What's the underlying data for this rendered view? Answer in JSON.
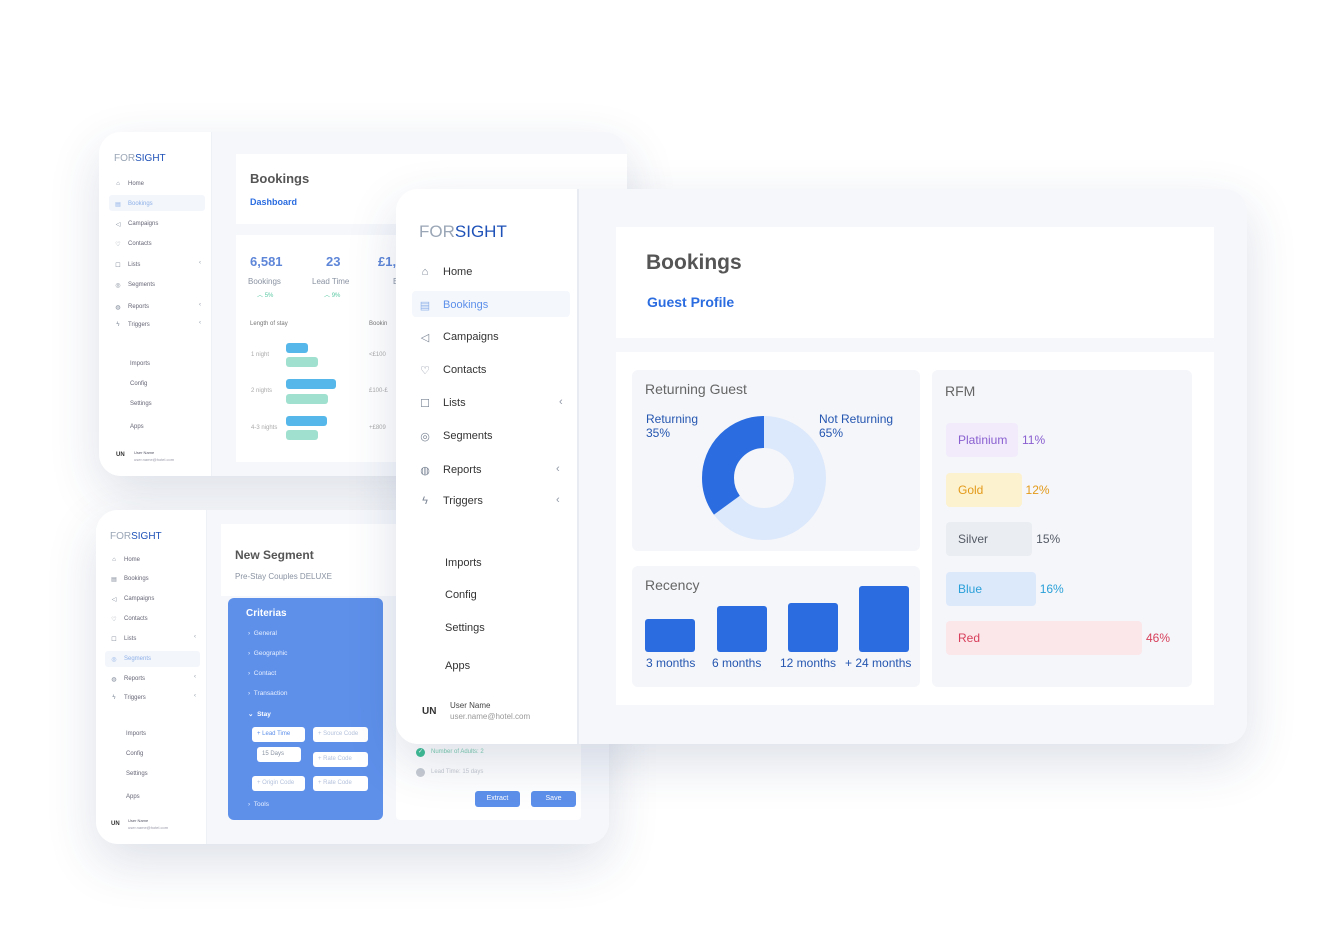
{
  "brand": {
    "logo_for": "FOR",
    "logo_sight": "SIGHT",
    "accent": "#2b6de0",
    "dark_blue": "#1f52b8"
  },
  "nav": {
    "items": [
      {
        "label": "Home",
        "icon": "home-icon"
      },
      {
        "label": "Bookings",
        "icon": "calendar-icon"
      },
      {
        "label": "Campaigns",
        "icon": "megaphone-icon"
      },
      {
        "label": "Contacts",
        "icon": "people-icon"
      },
      {
        "label": "Lists",
        "icon": "list-icon"
      },
      {
        "label": "Segments",
        "icon": "target-icon"
      },
      {
        "label": "Reports",
        "icon": "reports-icon"
      },
      {
        "label": "Triggers",
        "icon": "trigger-icon"
      }
    ],
    "sub_items": [
      "Imports",
      "Config",
      "Settings",
      "Apps"
    ],
    "user": {
      "initials": "UN",
      "name": "User Name",
      "email": "user.name@hotel.com"
    }
  },
  "card1": {
    "title": "Bookings",
    "subtitle": "Dashboard",
    "kpis": [
      {
        "value": "6,581",
        "label": "Bookings",
        "delta": "5%"
      },
      {
        "value": "23",
        "label": "Lead Time",
        "delta": "9%"
      },
      {
        "value": "£1,",
        "label": "B"
      }
    ],
    "length_of_stay": {
      "header": "Length of stay",
      "header2": "Bookin",
      "rows": [
        {
          "label": "1 night",
          "amount": "<£100"
        },
        {
          "label": "2 nights",
          "amount": "£100-£"
        },
        {
          "label": "4-3 nights",
          "amount": "+£809"
        }
      ]
    }
  },
  "card2": {
    "title": "New Segment",
    "subtitle": "Pre-Stay Couples DELUXE",
    "criterias": {
      "title": "Criterias",
      "items": [
        "General",
        "Geographic",
        "Contact",
        "Transaction",
        "Stay",
        "Tools"
      ],
      "tags": {
        "lead_time": "+ Lead Time",
        "days": "15 Days",
        "source_code": "+ Source Code",
        "rate_code": "+ Rate Code",
        "origin_code": "+ Origin Code",
        "rate_code2": "+ Rate Code"
      }
    },
    "conditions": [
      "Number of Adults: 2",
      "Lead Time: 15 days"
    ],
    "buttons": {
      "extract": "Extract",
      "save": "Save"
    }
  },
  "card3": {
    "title": "Bookings",
    "subtitle": "Guest Profile",
    "returning_guest": {
      "title": "Returning Guest",
      "returning_label": "Returning",
      "returning_pct": "35%",
      "not_returning_label": "Not Returning",
      "not_returning_pct": "65%",
      "returning_value": 35,
      "not_returning_value": 65,
      "colors": {
        "returning": "#2b6de0",
        "not_returning": "#dce8fb"
      }
    },
    "recency": {
      "title": "Recency",
      "categories": [
        "3 months",
        "6 months",
        "12 months",
        "+ 24 months"
      ],
      "values": [
        1.0,
        1.4,
        1.5,
        2.0
      ]
    },
    "rfm": {
      "title": "RFM",
      "tiers": [
        {
          "label": "Platinium",
          "pct": "11%",
          "value": 11,
          "bg": "#f1ebfb",
          "fg": "#8a5fd0"
        },
        {
          "label": "Gold",
          "pct": "12%",
          "value": 12,
          "bg": "#fdf2cf",
          "fg": "#e39a1a"
        },
        {
          "label": "Silver",
          "pct": "15%",
          "value": 15,
          "bg": "#eaedf1",
          "fg": "#555b66"
        },
        {
          "label": "Blue",
          "pct": "16%",
          "value": 16,
          "bg": "#dce9fb",
          "fg": "#2aa0d8"
        },
        {
          "label": "Red",
          "pct": "46%",
          "value": 46,
          "bg": "#fbe6ea",
          "fg": "#d8405b"
        }
      ]
    }
  }
}
